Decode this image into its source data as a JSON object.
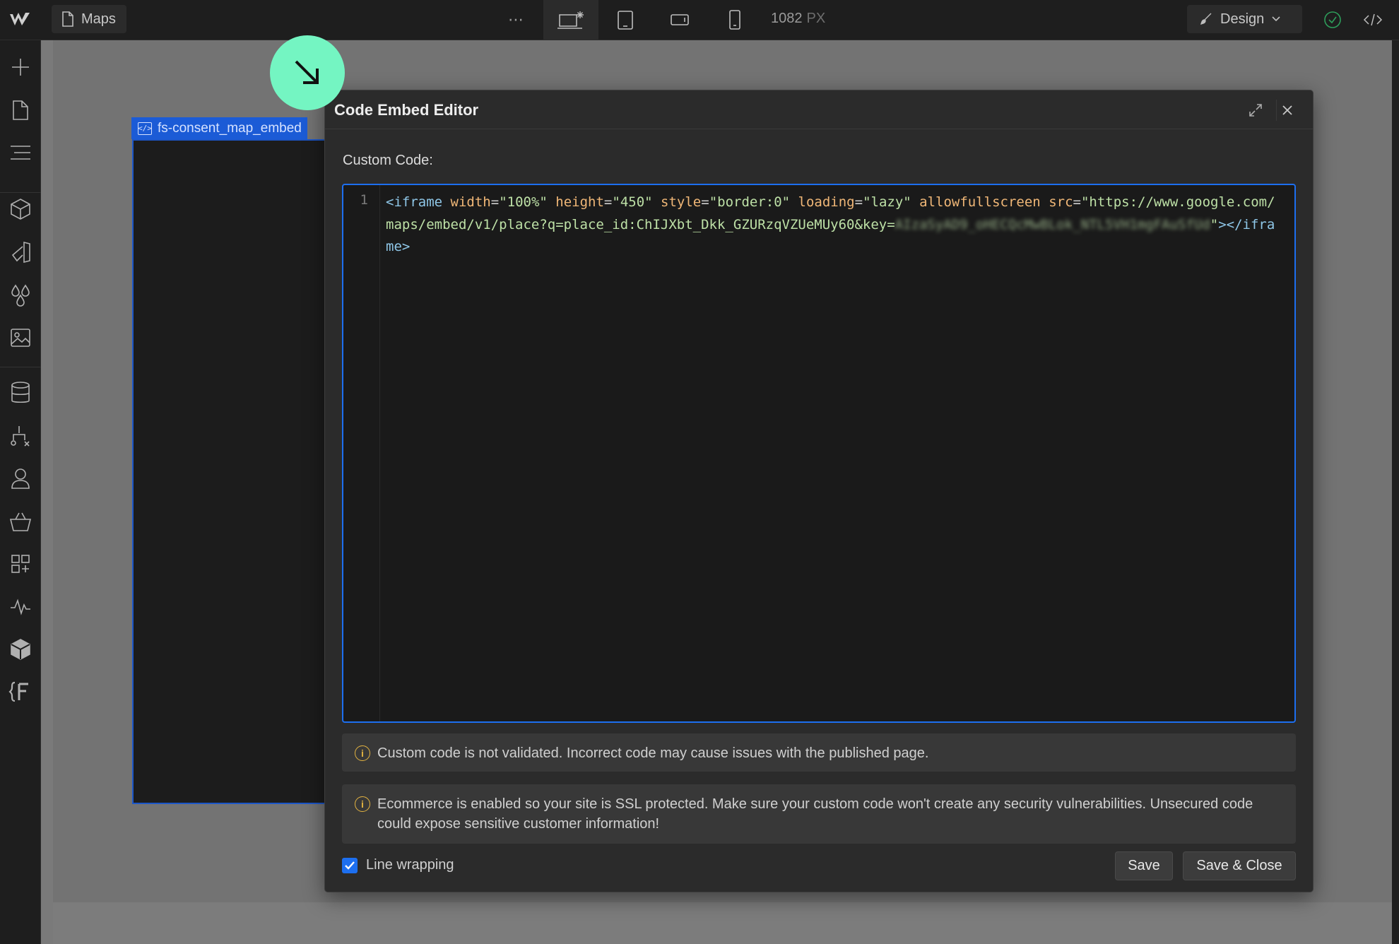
{
  "topbar": {
    "page_name": "Maps",
    "more_glyph": "⋯",
    "viewport_width": "1082",
    "viewport_unit": "PX",
    "mode_label": "Design"
  },
  "element": {
    "tag_label": "fs-consent_map_embed",
    "tag_icon_glyph": "</>"
  },
  "modal": {
    "title": "Code Embed Editor",
    "code_label": "Custom Code:",
    "line_number": "1",
    "code": {
      "t1": "<iframe",
      "a_width": "width",
      "v_width": "\"100%\"",
      "a_height": "height",
      "v_height": "\"450\"",
      "a_style": "style",
      "v_style": "\"border:0\"",
      "a_loading": "loading",
      "v_loading": "\"lazy\"",
      "a_allow": "allowfullscreen",
      "a_src": "src",
      "v_src_start": "\"https://www.google.com/maps/embed/v1/place?q=place_id:ChIJXbt_Dkk_GZURzqVZUeMUy60&key=",
      "v_key_blurred": "AIzaSyAD9_oHECQcMwBLok_NTL5VH1mgFAuSfUd",
      "v_src_end": "\"",
      "t_end": "></iframe>"
    },
    "notice_validation": "Custom code is not validated. Incorrect code may cause issues with the published page.",
    "notice_ssl": "Ecommerce is enabled so your site is SSL protected. Make sure your custom code won't create any security vulnerabilities. Unsecured code could expose sensitive customer information!",
    "line_wrapping_label": "Line wrapping",
    "line_wrapping_checked": true,
    "save_label": "Save",
    "save_close_label": "Save & Close"
  },
  "colors": {
    "accent_blue": "#1d6ff0",
    "cursor_mint": "#74f5c2",
    "info_yellow": "#e3b341"
  }
}
